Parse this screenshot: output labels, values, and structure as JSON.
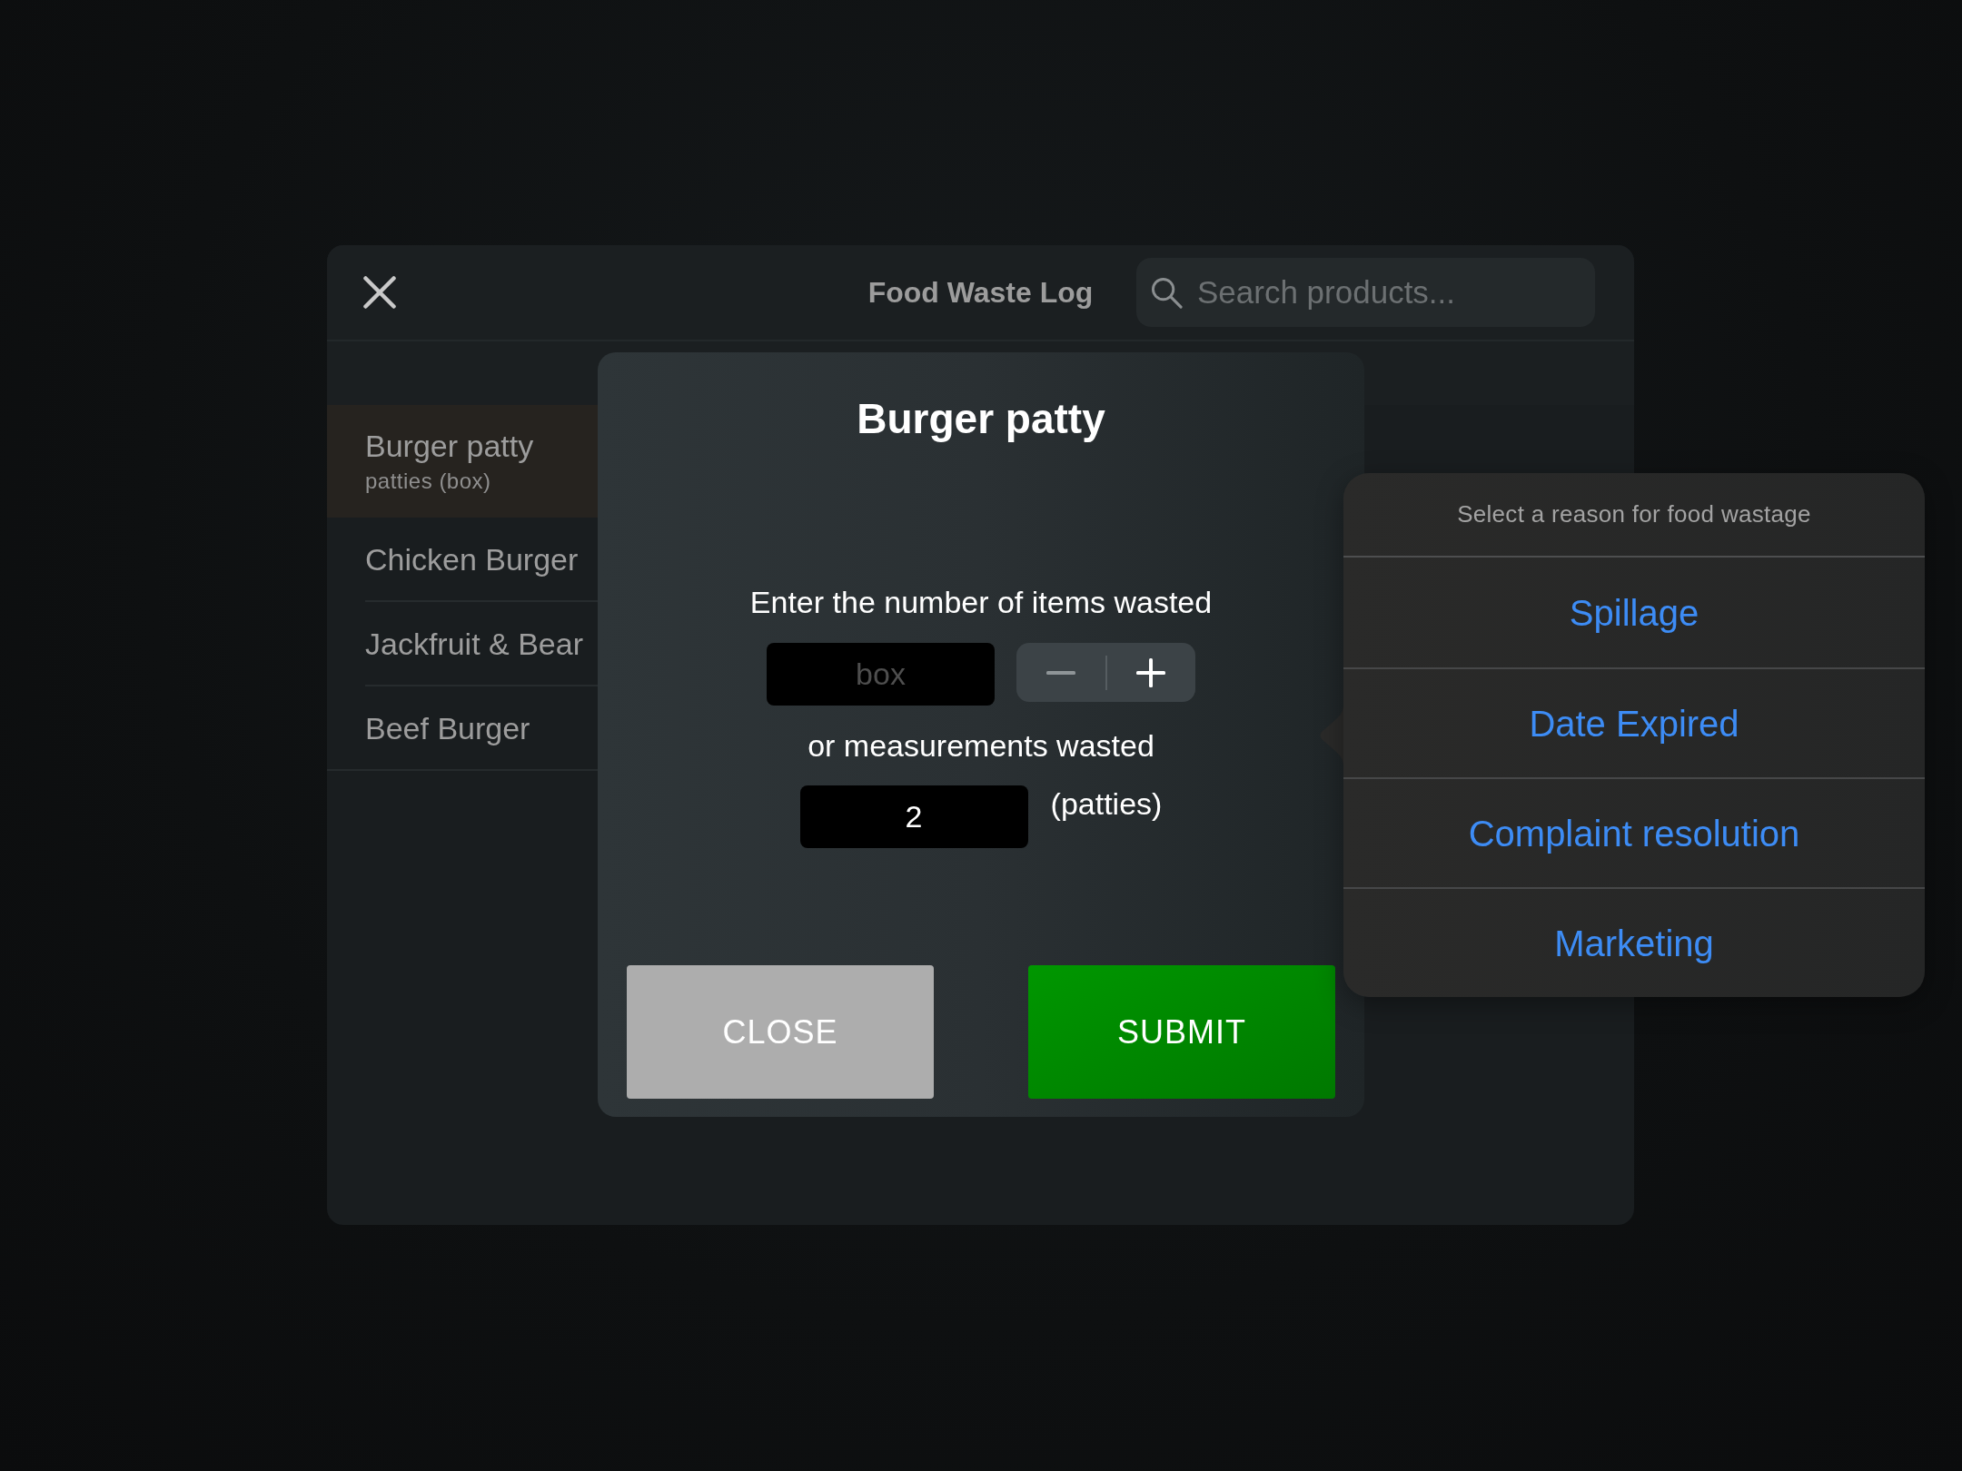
{
  "window": {
    "title": "Food Waste Log"
  },
  "search": {
    "placeholder": "Search products..."
  },
  "products": [
    {
      "name": "Burger patty",
      "unit": "patties (box)",
      "selected": true
    },
    {
      "name": "Chicken Burger",
      "selected": false
    },
    {
      "name": "Jackfruit & Bear",
      "selected": false
    },
    {
      "name": "Beef Burger",
      "selected": false
    }
  ],
  "dialog": {
    "title": "Burger patty",
    "count_prompt": "Enter the number of items wasted",
    "count_field": {
      "placeholder": "box"
    },
    "stepper": {
      "minus_disabled": true,
      "plus_disabled": false
    },
    "measure_prompt": "or measurements wasted",
    "measure_field": {
      "value": "2"
    },
    "measure_unit": "(patties)",
    "buttons": [
      {
        "label": "CLOSE",
        "kind": "secondary"
      },
      {
        "label": "SUBMIT",
        "kind": "primary"
      }
    ]
  },
  "reason_menu": {
    "title": "Select a reason for food wastage",
    "options": [
      "Spillage",
      "Date Expired",
      "Complaint resolution",
      "Marketing"
    ]
  }
}
